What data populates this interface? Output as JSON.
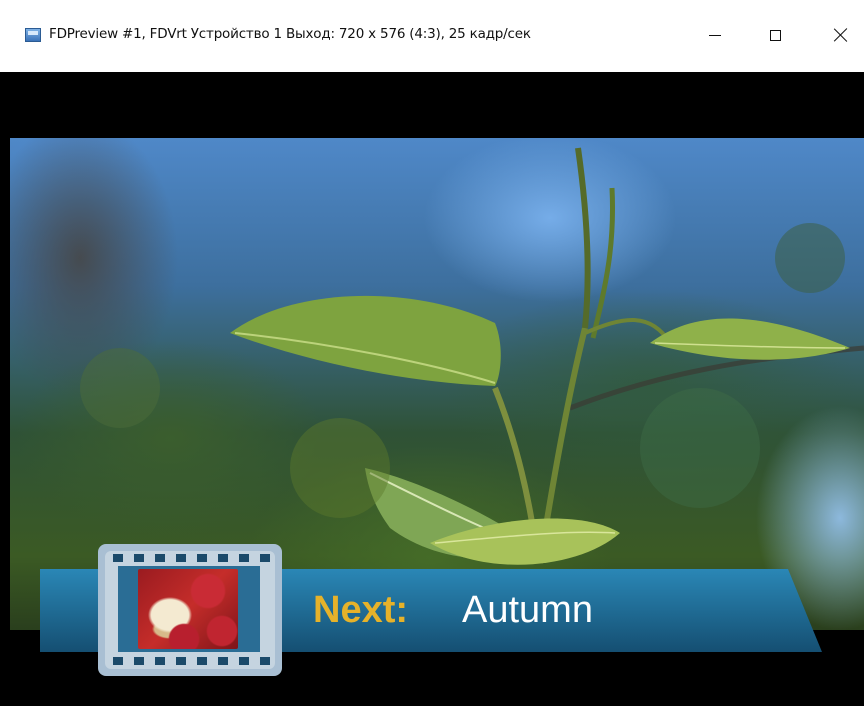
{
  "window": {
    "title": "FDPreview #1, FDVrt Устройство 1 Выход: 720 x 576 (4:3), 25 кадр/сек",
    "icon": "app-icon",
    "controls": {
      "minimize_icon": "minimize-icon",
      "maximize_icon": "maximize-icon",
      "close_icon": "close-icon"
    }
  },
  "preview": {
    "scene": "video-frame",
    "overlay": {
      "label": "Next:",
      "title": "Autumn",
      "label_color": "#e6b22a",
      "title_color": "#ffffff",
      "banner_color": "#1b6a95",
      "filmstrip_color": "#a9bfd3"
    }
  }
}
